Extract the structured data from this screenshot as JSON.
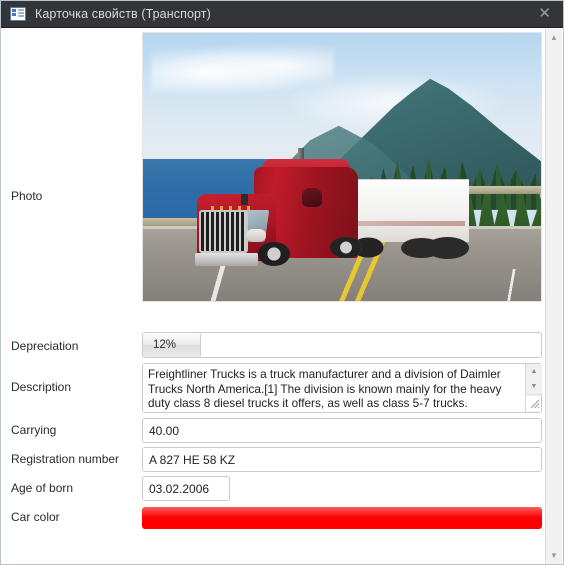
{
  "window": {
    "title": "Карточка свойств (Транспорт)",
    "icon": "property-card-icon",
    "close_label": "✕"
  },
  "form": {
    "fields": [
      {
        "label": "Photo",
        "name": "photo",
        "type": "image"
      },
      {
        "label": "Depreciation",
        "name": "depreciation",
        "type": "progress",
        "value": "12%"
      },
      {
        "label": "Description",
        "name": "description",
        "type": "textarea",
        "value": "Freightliner Trucks is a truck manufacturer and a division of Daimler Trucks North America.[1] The division is known mainly for the heavy duty class 8 diesel trucks it offers, as well as class 5-7 trucks."
      },
      {
        "label": "Carrying",
        "name": "carrying",
        "type": "text",
        "value": "40.00"
      },
      {
        "label": "Registration number",
        "name": "registration_number",
        "type": "text",
        "value": "A 827 HE 58 KZ"
      },
      {
        "label": "Age of born",
        "name": "age_of_born",
        "type": "date",
        "value": "03.02.2006"
      },
      {
        "label": "Car color",
        "name": "car_color",
        "type": "color",
        "value": "#ff0000"
      }
    ]
  },
  "photo": {
    "alt": "Red Freightliner semi truck with white trailer on a coastal highway",
    "subjects": [
      "red-truck-cab",
      "white-trailer",
      "mountain",
      "ocean",
      "pine-trees",
      "highway"
    ]
  },
  "scrollbars": {
    "up_arrow": "▲",
    "down_arrow": "▼",
    "resize_grip": "◢"
  },
  "colors": {
    "titlebar_bg": "#333538",
    "titlebar_text": "#d7d9db",
    "window_border": "#b7c4cf",
    "field_border": "#cccccc",
    "car_color": "#ff0000",
    "scrollbar_track": "#f1f1f1"
  }
}
